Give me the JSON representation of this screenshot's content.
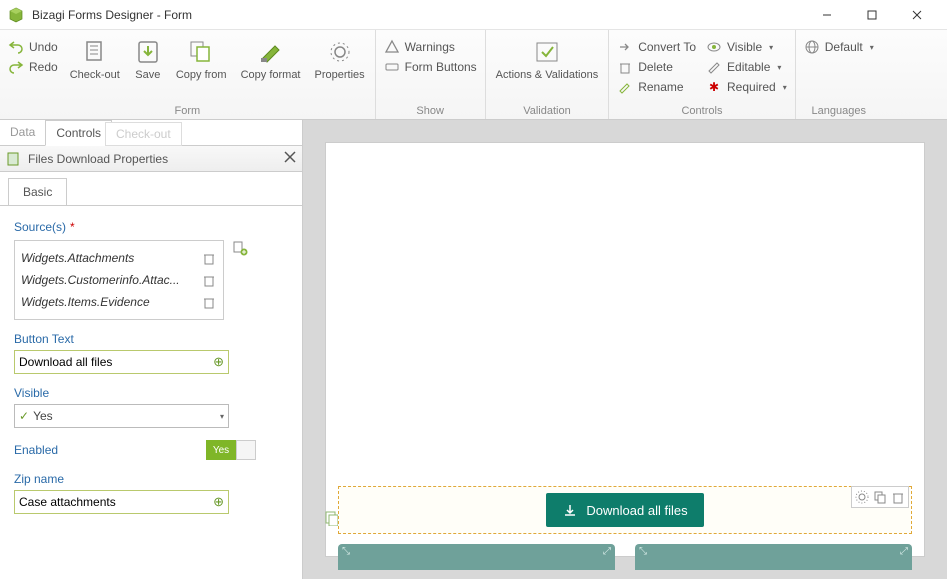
{
  "window": {
    "title": "Bizagi Forms Designer  -  Form"
  },
  "ribbon": {
    "undo": "Undo",
    "redo": "Redo",
    "checkout": "Check-out",
    "save": "Save",
    "copyfrom": "Copy from",
    "copyformat": "Copy format",
    "properties": "Properties",
    "warnings": "Warnings",
    "formbuttons": "Form Buttons",
    "actions": "Actions & Validations",
    "convertto": "Convert To",
    "delete": "Delete",
    "rename": "Rename",
    "visible": "Visible",
    "editable": "Editable",
    "required": "Required",
    "default": "Default",
    "groups": {
      "form": "Form",
      "show": "Show",
      "validation": "Validation",
      "controls": "Controls",
      "languages": "Languages"
    }
  },
  "sidetabs": {
    "data": "Data",
    "controls": "Controls",
    "ghost": "Check-out"
  },
  "panel": {
    "title": "Files Download Properties",
    "tab_basic": "Basic",
    "sources_label": "Source(s)",
    "sources": [
      "Widgets.Attachments",
      "Widgets.Customerinfo.Attac...",
      "Widgets.Items.Evidence"
    ],
    "buttontext_label": "Button Text",
    "buttontext_value": "Download all files",
    "visible_label": "Visible",
    "visible_value": "Yes",
    "enabled_label": "Enabled",
    "enabled_value": "Yes",
    "zipname_label": "Zip name",
    "zipname_value": "Case attachments"
  },
  "canvas": {
    "download_button": "Download all files"
  }
}
